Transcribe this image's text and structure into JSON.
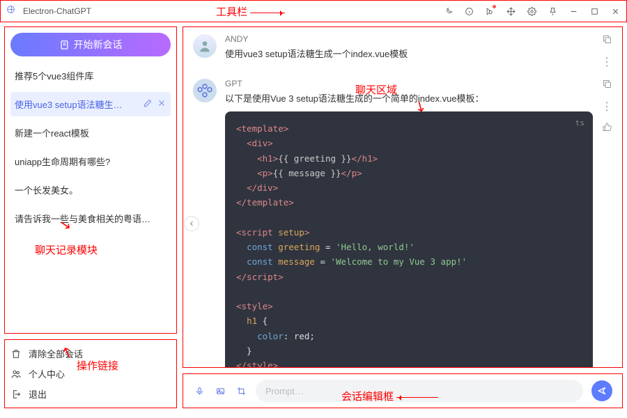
{
  "app_title": "Electron-ChatGPT",
  "annotations": {
    "toolbar": "工具栏",
    "history_module": "聊天记录模块",
    "action_links": "操作链接",
    "chat_area": "聊天区域",
    "input_box": "会话编辑框"
  },
  "new_chat_label": "开始新会话",
  "history": [
    {
      "label": "推荐5个vue3组件库",
      "active": false
    },
    {
      "label": "使用vue3 setup语法糖生…",
      "active": true
    },
    {
      "label": "新建一个react模板",
      "active": false
    },
    {
      "label": "uniapp生命周期有哪些?",
      "active": false
    },
    {
      "label": "一个长发美女。",
      "active": false
    },
    {
      "label": "请告诉我一些与美食相关的粤语…",
      "active": false
    }
  ],
  "ops": {
    "clear": "清除全部会话",
    "profile": "个人中心",
    "logout": "退出"
  },
  "messages": {
    "user": {
      "author": "ANDY",
      "text": "使用vue3 setup语法糖生成一个index.vue模板"
    },
    "gpt": {
      "author": "GPT",
      "text": "以下是使用Vue 3 setup语法糖生成的一个简单的index.vue模板：",
      "code_lang": "ts",
      "code": {
        "greeting_str": "'Hello, world!'",
        "message_str": "'Welcome to my Vue 3 app!'",
        "color_val": "red"
      }
    }
  },
  "input_placeholder": "Prompt…"
}
